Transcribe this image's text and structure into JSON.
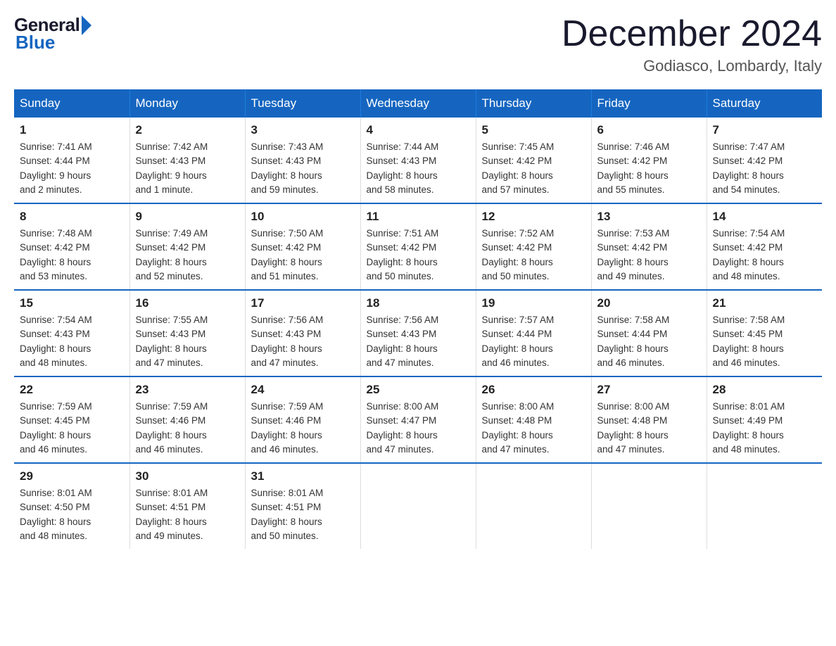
{
  "logo": {
    "general": "General",
    "blue": "Blue"
  },
  "title": "December 2024",
  "location": "Godiasco, Lombardy, Italy",
  "days_of_week": [
    "Sunday",
    "Monday",
    "Tuesday",
    "Wednesday",
    "Thursday",
    "Friday",
    "Saturday"
  ],
  "weeks": [
    [
      {
        "day": "1",
        "sunrise": "7:41 AM",
        "sunset": "4:44 PM",
        "daylight": "9 hours and 2 minutes."
      },
      {
        "day": "2",
        "sunrise": "7:42 AM",
        "sunset": "4:43 PM",
        "daylight": "9 hours and 1 minute."
      },
      {
        "day": "3",
        "sunrise": "7:43 AM",
        "sunset": "4:43 PM",
        "daylight": "8 hours and 59 minutes."
      },
      {
        "day": "4",
        "sunrise": "7:44 AM",
        "sunset": "4:43 PM",
        "daylight": "8 hours and 58 minutes."
      },
      {
        "day": "5",
        "sunrise": "7:45 AM",
        "sunset": "4:42 PM",
        "daylight": "8 hours and 57 minutes."
      },
      {
        "day": "6",
        "sunrise": "7:46 AM",
        "sunset": "4:42 PM",
        "daylight": "8 hours and 55 minutes."
      },
      {
        "day": "7",
        "sunrise": "7:47 AM",
        "sunset": "4:42 PM",
        "daylight": "8 hours and 54 minutes."
      }
    ],
    [
      {
        "day": "8",
        "sunrise": "7:48 AM",
        "sunset": "4:42 PM",
        "daylight": "8 hours and 53 minutes."
      },
      {
        "day": "9",
        "sunrise": "7:49 AM",
        "sunset": "4:42 PM",
        "daylight": "8 hours and 52 minutes."
      },
      {
        "day": "10",
        "sunrise": "7:50 AM",
        "sunset": "4:42 PM",
        "daylight": "8 hours and 51 minutes."
      },
      {
        "day": "11",
        "sunrise": "7:51 AM",
        "sunset": "4:42 PM",
        "daylight": "8 hours and 50 minutes."
      },
      {
        "day": "12",
        "sunrise": "7:52 AM",
        "sunset": "4:42 PM",
        "daylight": "8 hours and 50 minutes."
      },
      {
        "day": "13",
        "sunrise": "7:53 AM",
        "sunset": "4:42 PM",
        "daylight": "8 hours and 49 minutes."
      },
      {
        "day": "14",
        "sunrise": "7:54 AM",
        "sunset": "4:42 PM",
        "daylight": "8 hours and 48 minutes."
      }
    ],
    [
      {
        "day": "15",
        "sunrise": "7:54 AM",
        "sunset": "4:43 PM",
        "daylight": "8 hours and 48 minutes."
      },
      {
        "day": "16",
        "sunrise": "7:55 AM",
        "sunset": "4:43 PM",
        "daylight": "8 hours and 47 minutes."
      },
      {
        "day": "17",
        "sunrise": "7:56 AM",
        "sunset": "4:43 PM",
        "daylight": "8 hours and 47 minutes."
      },
      {
        "day": "18",
        "sunrise": "7:56 AM",
        "sunset": "4:43 PM",
        "daylight": "8 hours and 47 minutes."
      },
      {
        "day": "19",
        "sunrise": "7:57 AM",
        "sunset": "4:44 PM",
        "daylight": "8 hours and 46 minutes."
      },
      {
        "day": "20",
        "sunrise": "7:58 AM",
        "sunset": "4:44 PM",
        "daylight": "8 hours and 46 minutes."
      },
      {
        "day": "21",
        "sunrise": "7:58 AM",
        "sunset": "4:45 PM",
        "daylight": "8 hours and 46 minutes."
      }
    ],
    [
      {
        "day": "22",
        "sunrise": "7:59 AM",
        "sunset": "4:45 PM",
        "daylight": "8 hours and 46 minutes."
      },
      {
        "day": "23",
        "sunrise": "7:59 AM",
        "sunset": "4:46 PM",
        "daylight": "8 hours and 46 minutes."
      },
      {
        "day": "24",
        "sunrise": "7:59 AM",
        "sunset": "4:46 PM",
        "daylight": "8 hours and 46 minutes."
      },
      {
        "day": "25",
        "sunrise": "8:00 AM",
        "sunset": "4:47 PM",
        "daylight": "8 hours and 47 minutes."
      },
      {
        "day": "26",
        "sunrise": "8:00 AM",
        "sunset": "4:48 PM",
        "daylight": "8 hours and 47 minutes."
      },
      {
        "day": "27",
        "sunrise": "8:00 AM",
        "sunset": "4:48 PM",
        "daylight": "8 hours and 47 minutes."
      },
      {
        "day": "28",
        "sunrise": "8:01 AM",
        "sunset": "4:49 PM",
        "daylight": "8 hours and 48 minutes."
      }
    ],
    [
      {
        "day": "29",
        "sunrise": "8:01 AM",
        "sunset": "4:50 PM",
        "daylight": "8 hours and 48 minutes."
      },
      {
        "day": "30",
        "sunrise": "8:01 AM",
        "sunset": "4:51 PM",
        "daylight": "8 hours and 49 minutes."
      },
      {
        "day": "31",
        "sunrise": "8:01 AM",
        "sunset": "4:51 PM",
        "daylight": "8 hours and 50 minutes."
      },
      null,
      null,
      null,
      null
    ]
  ],
  "labels": {
    "sunrise": "Sunrise:",
    "sunset": "Sunset:",
    "daylight": "Daylight:"
  }
}
